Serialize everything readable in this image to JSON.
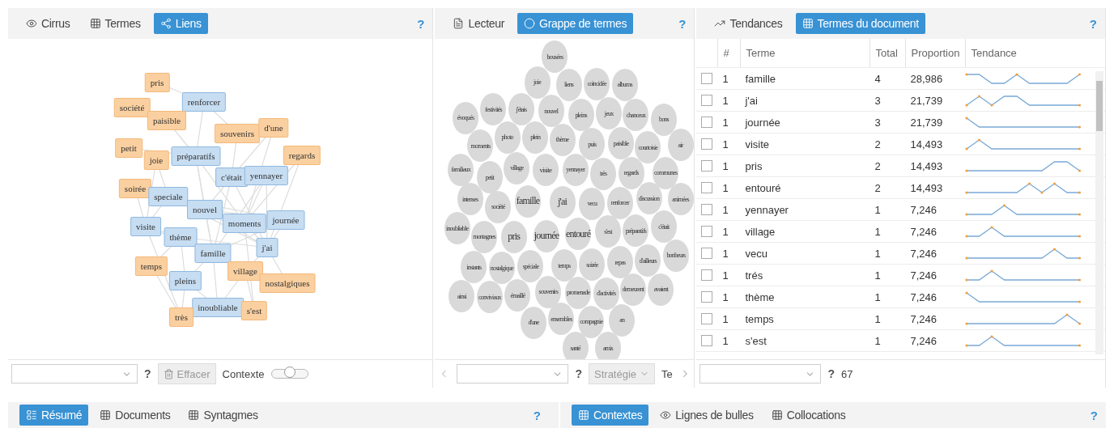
{
  "left_panel": {
    "tabs": [
      {
        "label": "Cirrus",
        "kind": "eye",
        "selected": false
      },
      {
        "label": "Termes",
        "kind": "grid",
        "selected": false
      },
      {
        "label": "Liens",
        "kind": "share",
        "selected": true
      }
    ],
    "help": "?",
    "nodes": [
      {
        "label": "pris",
        "color": "#fbd0a0"
      },
      {
        "label": "renforcer",
        "color": "#c6ddf2"
      },
      {
        "label": "société",
        "color": "#fbd0a0"
      },
      {
        "label": "paisible",
        "color": "#fbd0a0"
      },
      {
        "label": "souvenirs",
        "color": "#fbd0a0"
      },
      {
        "label": "d'une",
        "color": "#fbd0a0"
      },
      {
        "label": "regards",
        "color": "#fbd0a0"
      },
      {
        "label": "petit",
        "color": "#fbd0a0"
      },
      {
        "label": "joie",
        "color": "#fbd0a0"
      },
      {
        "label": "préparatifs",
        "color": "#c6ddf2"
      },
      {
        "label": "c'était",
        "color": "#c6ddf2"
      },
      {
        "label": "yennayer",
        "color": "#c6ddf2"
      },
      {
        "label": "soirée",
        "color": "#fbd0a0"
      },
      {
        "label": "speciale",
        "color": "#c6ddf2"
      },
      {
        "label": "nouvel",
        "color": "#c6ddf2"
      },
      {
        "label": "moments",
        "color": "#c6ddf2"
      },
      {
        "label": "journée",
        "color": "#c6ddf2"
      },
      {
        "label": "visite",
        "color": "#c6ddf2"
      },
      {
        "label": "thème",
        "color": "#c6ddf2"
      },
      {
        "label": "j'ai",
        "color": "#c6ddf2"
      },
      {
        "label": "famille",
        "color": "#c6ddf2"
      },
      {
        "label": "temps",
        "color": "#fbd0a0"
      },
      {
        "label": "village",
        "color": "#fbd0a0"
      },
      {
        "label": "nostalgiques",
        "color": "#fbd0a0"
      },
      {
        "label": "pleins",
        "color": "#c6ddf2"
      },
      {
        "label": "inoubliable",
        "color": "#c6ddf2"
      },
      {
        "label": "s'est",
        "color": "#fbd0a0"
      },
      {
        "label": "très",
        "color": "#fbd0a0"
      }
    ],
    "footer": {
      "help": "?",
      "clear_button": "Effacer",
      "context_label": "Contexte",
      "context_slider": {
        "level": 0.5
      }
    }
  },
  "middle_panel": {
    "tabs": [
      {
        "label": "Lecteur",
        "kind": "doc",
        "selected": false
      },
      {
        "label": "Grappe de termes",
        "kind": "circle",
        "selected": true
      }
    ],
    "help": "?",
    "bubbles": [
      {
        "label": "bousées",
        "kind": "small"
      },
      {
        "label": "joie",
        "kind": "small"
      },
      {
        "label": "liens",
        "kind": "small"
      },
      {
        "label": "coïncidée",
        "kind": "small"
      },
      {
        "label": "albums",
        "kind": "small"
      },
      {
        "label": "évoqués",
        "kind": "small"
      },
      {
        "label": "festivités",
        "kind": "small"
      },
      {
        "label": "j'étais",
        "kind": "small"
      },
      {
        "label": "nouvel",
        "kind": "small"
      },
      {
        "label": "pleins",
        "kind": "small"
      },
      {
        "label": "jeux",
        "kind": "small"
      },
      {
        "label": "chanceux",
        "kind": "small"
      },
      {
        "label": "bons",
        "kind": "small"
      },
      {
        "label": "moments",
        "kind": "small"
      },
      {
        "label": "photo",
        "kind": "small"
      },
      {
        "label": "plein",
        "kind": "small"
      },
      {
        "label": "thème",
        "kind": "small"
      },
      {
        "label": "puis",
        "kind": "small"
      },
      {
        "label": "paisible",
        "kind": "small"
      },
      {
        "label": "courtoisie",
        "kind": "small"
      },
      {
        "label": "air",
        "kind": "small"
      },
      {
        "label": "familiaux",
        "kind": "small"
      },
      {
        "label": "petit",
        "kind": "small"
      },
      {
        "label": "village",
        "kind": "small"
      },
      {
        "label": "visite",
        "kind": "medium"
      },
      {
        "label": "yennayer",
        "kind": "small"
      },
      {
        "label": "très",
        "kind": "small"
      },
      {
        "label": "regards",
        "kind": "small"
      },
      {
        "label": "communes",
        "kind": "small"
      },
      {
        "label": "intenses",
        "kind": "small"
      },
      {
        "label": "société",
        "kind": "small"
      },
      {
        "label": "famille",
        "kind": "big"
      },
      {
        "label": "j'ai",
        "kind": "big"
      },
      {
        "label": "vecu",
        "kind": "small"
      },
      {
        "label": "renforcer",
        "kind": "small"
      },
      {
        "label": "discussion",
        "kind": "small"
      },
      {
        "label": "animées",
        "kind": "small"
      },
      {
        "label": "inoubliable",
        "kind": "small"
      },
      {
        "label": "montagnes",
        "kind": "small"
      },
      {
        "label": "pris",
        "kind": "big"
      },
      {
        "label": "journée",
        "kind": "big"
      },
      {
        "label": "entouré",
        "kind": "big"
      },
      {
        "label": "s'est",
        "kind": "small"
      },
      {
        "label": "préparatifs",
        "kind": "small"
      },
      {
        "label": "c'était",
        "kind": "small"
      },
      {
        "label": "instants",
        "kind": "small"
      },
      {
        "label": "nostalgique",
        "kind": "small"
      },
      {
        "label": "spéciale",
        "kind": "small"
      },
      {
        "label": "temps",
        "kind": "small"
      },
      {
        "label": "soirée",
        "kind": "small"
      },
      {
        "label": "repas",
        "kind": "small"
      },
      {
        "label": "d'ailleurs",
        "kind": "small"
      },
      {
        "label": "bonheurs",
        "kind": "small"
      },
      {
        "label": "ainsi",
        "kind": "small"
      },
      {
        "label": "conviviaux",
        "kind": "small"
      },
      {
        "label": "émaillé",
        "kind": "small"
      },
      {
        "label": "souvenirs",
        "kind": "small"
      },
      {
        "label": "promenade",
        "kind": "small"
      },
      {
        "label": "d'activités",
        "kind": "small"
      },
      {
        "label": "demeurent",
        "kind": "small"
      },
      {
        "label": "avaient",
        "kind": "small"
      },
      {
        "label": "d'une",
        "kind": "small"
      },
      {
        "label": "ensembles",
        "kind": "small"
      },
      {
        "label": "compagnie",
        "kind": "small"
      },
      {
        "label": "an",
        "kind": "small"
      },
      {
        "label": "santé",
        "kind": "small"
      },
      {
        "label": "amis",
        "kind": "small"
      }
    ],
    "footer": {
      "help": "?",
      "strategy_button": "Stratégie",
      "cut_text": "Te"
    }
  },
  "right_panel": {
    "tabs": [
      {
        "label": "Tendances",
        "kind": "chart",
        "selected": false
      },
      {
        "label": "Termes du document",
        "kind": "grid",
        "selected": true
      }
    ],
    "help": "?",
    "columns": [
      "#",
      "Terme",
      "Total",
      "Proportion",
      "Tendance"
    ],
    "rows": [
      {
        "checked": false,
        "num": "1",
        "term": "famille",
        "total": "4",
        "proportion": "28,986"
      },
      {
        "checked": false,
        "num": "1",
        "term": "j'ai",
        "total": "3",
        "proportion": "21,739"
      },
      {
        "checked": false,
        "num": "1",
        "term": "journée",
        "total": "3",
        "proportion": "21,739"
      },
      {
        "checked": false,
        "num": "1",
        "term": "visite",
        "total": "2",
        "proportion": "14,493"
      },
      {
        "checked": false,
        "num": "1",
        "term": "pris",
        "total": "2",
        "proportion": "14,493"
      },
      {
        "checked": false,
        "num": "1",
        "term": "entouré",
        "total": "2",
        "proportion": "14,493"
      },
      {
        "checked": false,
        "num": "1",
        "term": "yennayer",
        "total": "1",
        "proportion": "7,246"
      },
      {
        "checked": false,
        "num": "1",
        "term": "village",
        "total": "1",
        "proportion": "7,246"
      },
      {
        "checked": false,
        "num": "1",
        "term": "vecu",
        "total": "1",
        "proportion": "7,246"
      },
      {
        "checked": false,
        "num": "1",
        "term": "trés",
        "total": "1",
        "proportion": "7,246"
      },
      {
        "checked": false,
        "num": "1",
        "term": "thème",
        "total": "1",
        "proportion": "7,246"
      },
      {
        "checked": false,
        "num": "1",
        "term": "temps",
        "total": "1",
        "proportion": "7,246"
      },
      {
        "checked": false,
        "num": "1",
        "term": "s'est",
        "total": "1",
        "proportion": "7,246"
      }
    ],
    "footer": {
      "help": "?",
      "count": "67"
    }
  },
  "bottom_left": {
    "tabs": [
      {
        "label": "Résumé",
        "kind": "summary",
        "selected": true
      },
      {
        "label": "Documents",
        "kind": "grid",
        "selected": false
      },
      {
        "label": "Syntagmes",
        "kind": "grid",
        "selected": false
      }
    ],
    "help": "?"
  },
  "bottom_right": {
    "tabs": [
      {
        "label": "Contextes",
        "kind": "grid",
        "selected": true
      },
      {
        "label": "Lignes de bulles",
        "kind": "eye",
        "selected": false
      },
      {
        "label": "Collocations",
        "kind": "grid",
        "selected": false
      }
    ],
    "help": "?"
  }
}
